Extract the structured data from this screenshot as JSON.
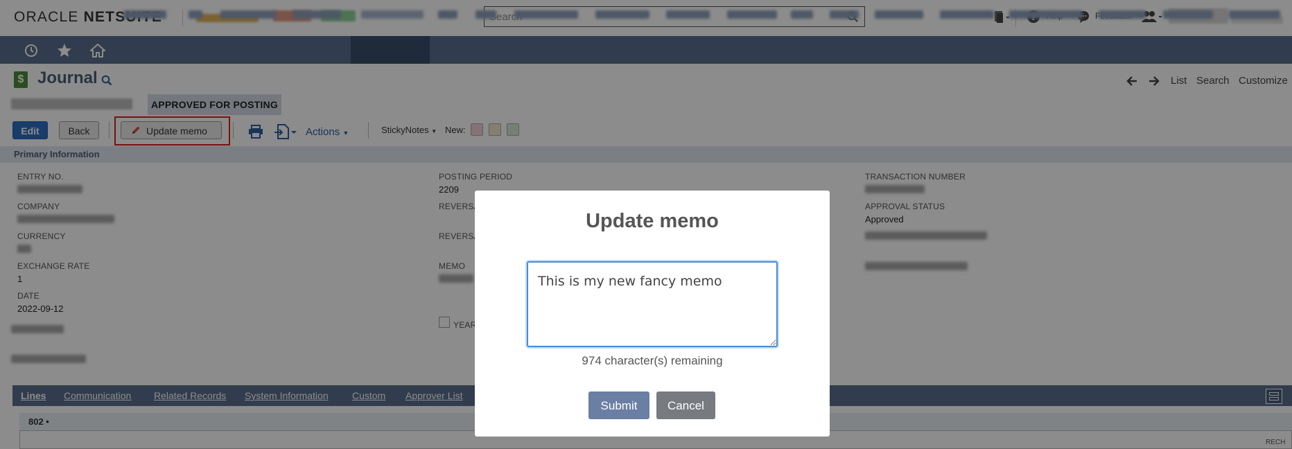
{
  "header": {
    "logo_light": "ORACLE ",
    "logo_bold": "NETSUITE",
    "search_placeholder": "Search",
    "help_label": "Help",
    "feedback_label": "Feedback"
  },
  "page": {
    "title": "Journal",
    "status": "APPROVED FOR POSTING",
    "nav_links": [
      "List",
      "Search",
      "Customize"
    ]
  },
  "toolbar": {
    "edit_label": "Edit",
    "back_label": "Back",
    "update_memo_label": "Update memo",
    "actions_label": "Actions",
    "sticky_notes_label": "StickyNotes",
    "new_label": "New:",
    "swatch_colors": [
      "#f2cfd7",
      "#f3e8c9",
      "#d3ecd0"
    ]
  },
  "primary_info": {
    "section_title": "Primary Information",
    "col1": {
      "entry_no_label": "ENTRY NO.",
      "company_label": "COMPANY",
      "currency_label": "CURRENCY",
      "exchange_rate_label": "EXCHANGE RATE",
      "exchange_rate_value": "1",
      "date_label": "DATE",
      "date_value": "2022-09-12"
    },
    "col2": {
      "posting_period_label": "POSTING PERIOD",
      "posting_period_value": "2209",
      "reversal_label_1": "REVERSAL",
      "reversal_label_2": "REVERSAL",
      "memo_label": "MEMO",
      "year_label": "YEAR"
    },
    "col3": {
      "transaction_number_label": "TRANSACTION NUMBER",
      "approval_status_label": "APPROVAL STATUS",
      "approval_status_value": "Approved"
    }
  },
  "tabs": [
    "Lines",
    "Communication",
    "Related Records",
    "System Information",
    "Custom",
    "Approver List"
  ],
  "sublist": {
    "count_label": "802 •",
    "column_fragment": "RECH"
  },
  "modal": {
    "title": "Update memo",
    "memo_value": "This is my new fancy memo",
    "chars_remaining": "974 character(s) remaining",
    "submit_label": "Submit",
    "cancel_label": "Cancel"
  },
  "colors": {
    "nav_bar": "#5a6f8f",
    "edit_button": "#2f6fc4",
    "submit_button": "#6b7fa5",
    "cancel_button": "#777b80",
    "focus_outline": "#e02020"
  }
}
